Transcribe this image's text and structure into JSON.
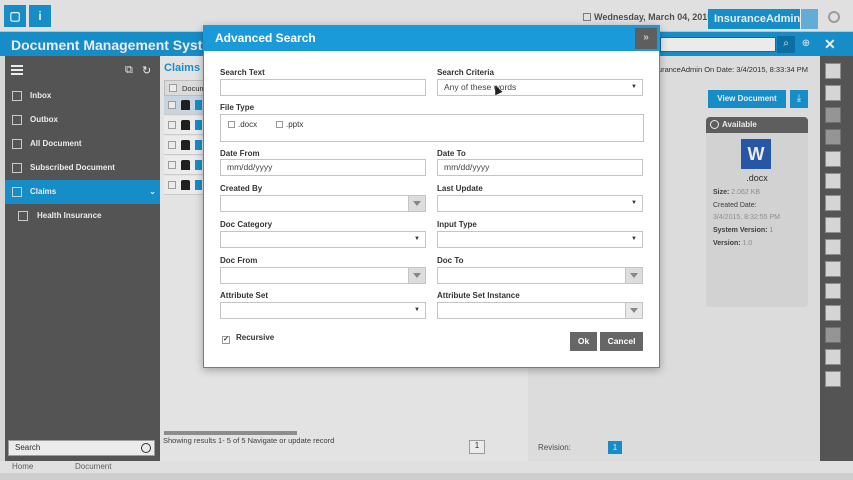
{
  "topbar": {
    "date": "Wednesday, March 04, 2015",
    "user": "InsuranceAdmin",
    "info_icon": "i"
  },
  "app": {
    "title": "Document Management Syst"
  },
  "sidebar": {
    "items": [
      {
        "label": "Inbox"
      },
      {
        "label": "Outbox"
      },
      {
        "label": "All Document"
      },
      {
        "label": "Subscribed Document"
      },
      {
        "label": "Claims"
      },
      {
        "label": "Health Insurance"
      }
    ],
    "search_label": "Search"
  },
  "breadcrumbs": [
    "Home",
    "Document"
  ],
  "list": {
    "title": "Claims",
    "header": "Docum",
    "footer": "Showing results 1- 5 of 5  Navigate or update record",
    "page": "1"
  },
  "details": {
    "info": "nsuranceAdmin On Date: 3/4/2015, 8:33:34 PM",
    "view_button": "View Document",
    "status": "Available",
    "extension": ".docx",
    "size_label": "Size:",
    "size_value": "2.062 KB",
    "created_label": "Created Date:",
    "created_value": "3/4/2015, 8:32:55 PM",
    "sysver_label": "System Version:",
    "sysver_value": "1",
    "version_label": "Version:",
    "version_value": "1.0",
    "revision_label": "Revision:",
    "revision_value": "1"
  },
  "modal": {
    "title": "Advanced Search",
    "close": "»",
    "search_text_label": "Search Text",
    "search_criteria_label": "Search Criteria",
    "search_criteria_value": "Any of these words",
    "file_type_label": "File Type",
    "file_types": [
      ".docx",
      ".pptx"
    ],
    "date_from_label": "Date From",
    "date_from_placeholder": "mm/dd/yyyy",
    "date_to_label": "Date To",
    "date_to_placeholder": "mm/dd/yyyy",
    "created_by_label": "Created By",
    "last_update_label": "Last Update",
    "doc_category_label": "Doc Category",
    "input_type_label": "Input Type",
    "doc_from_label": "Doc From",
    "doc_to_label": "Doc To",
    "attribute_set_label": "Attribute Set",
    "attribute_set_instance_label": "Attribute Set Instance",
    "recursive_label": "Recursive",
    "ok_label": "Ok",
    "cancel_label": "Cancel"
  },
  "colors": {
    "accent": "#1a9ad9",
    "sidebar": "#5c5c5c",
    "button_dark": "#666666"
  }
}
